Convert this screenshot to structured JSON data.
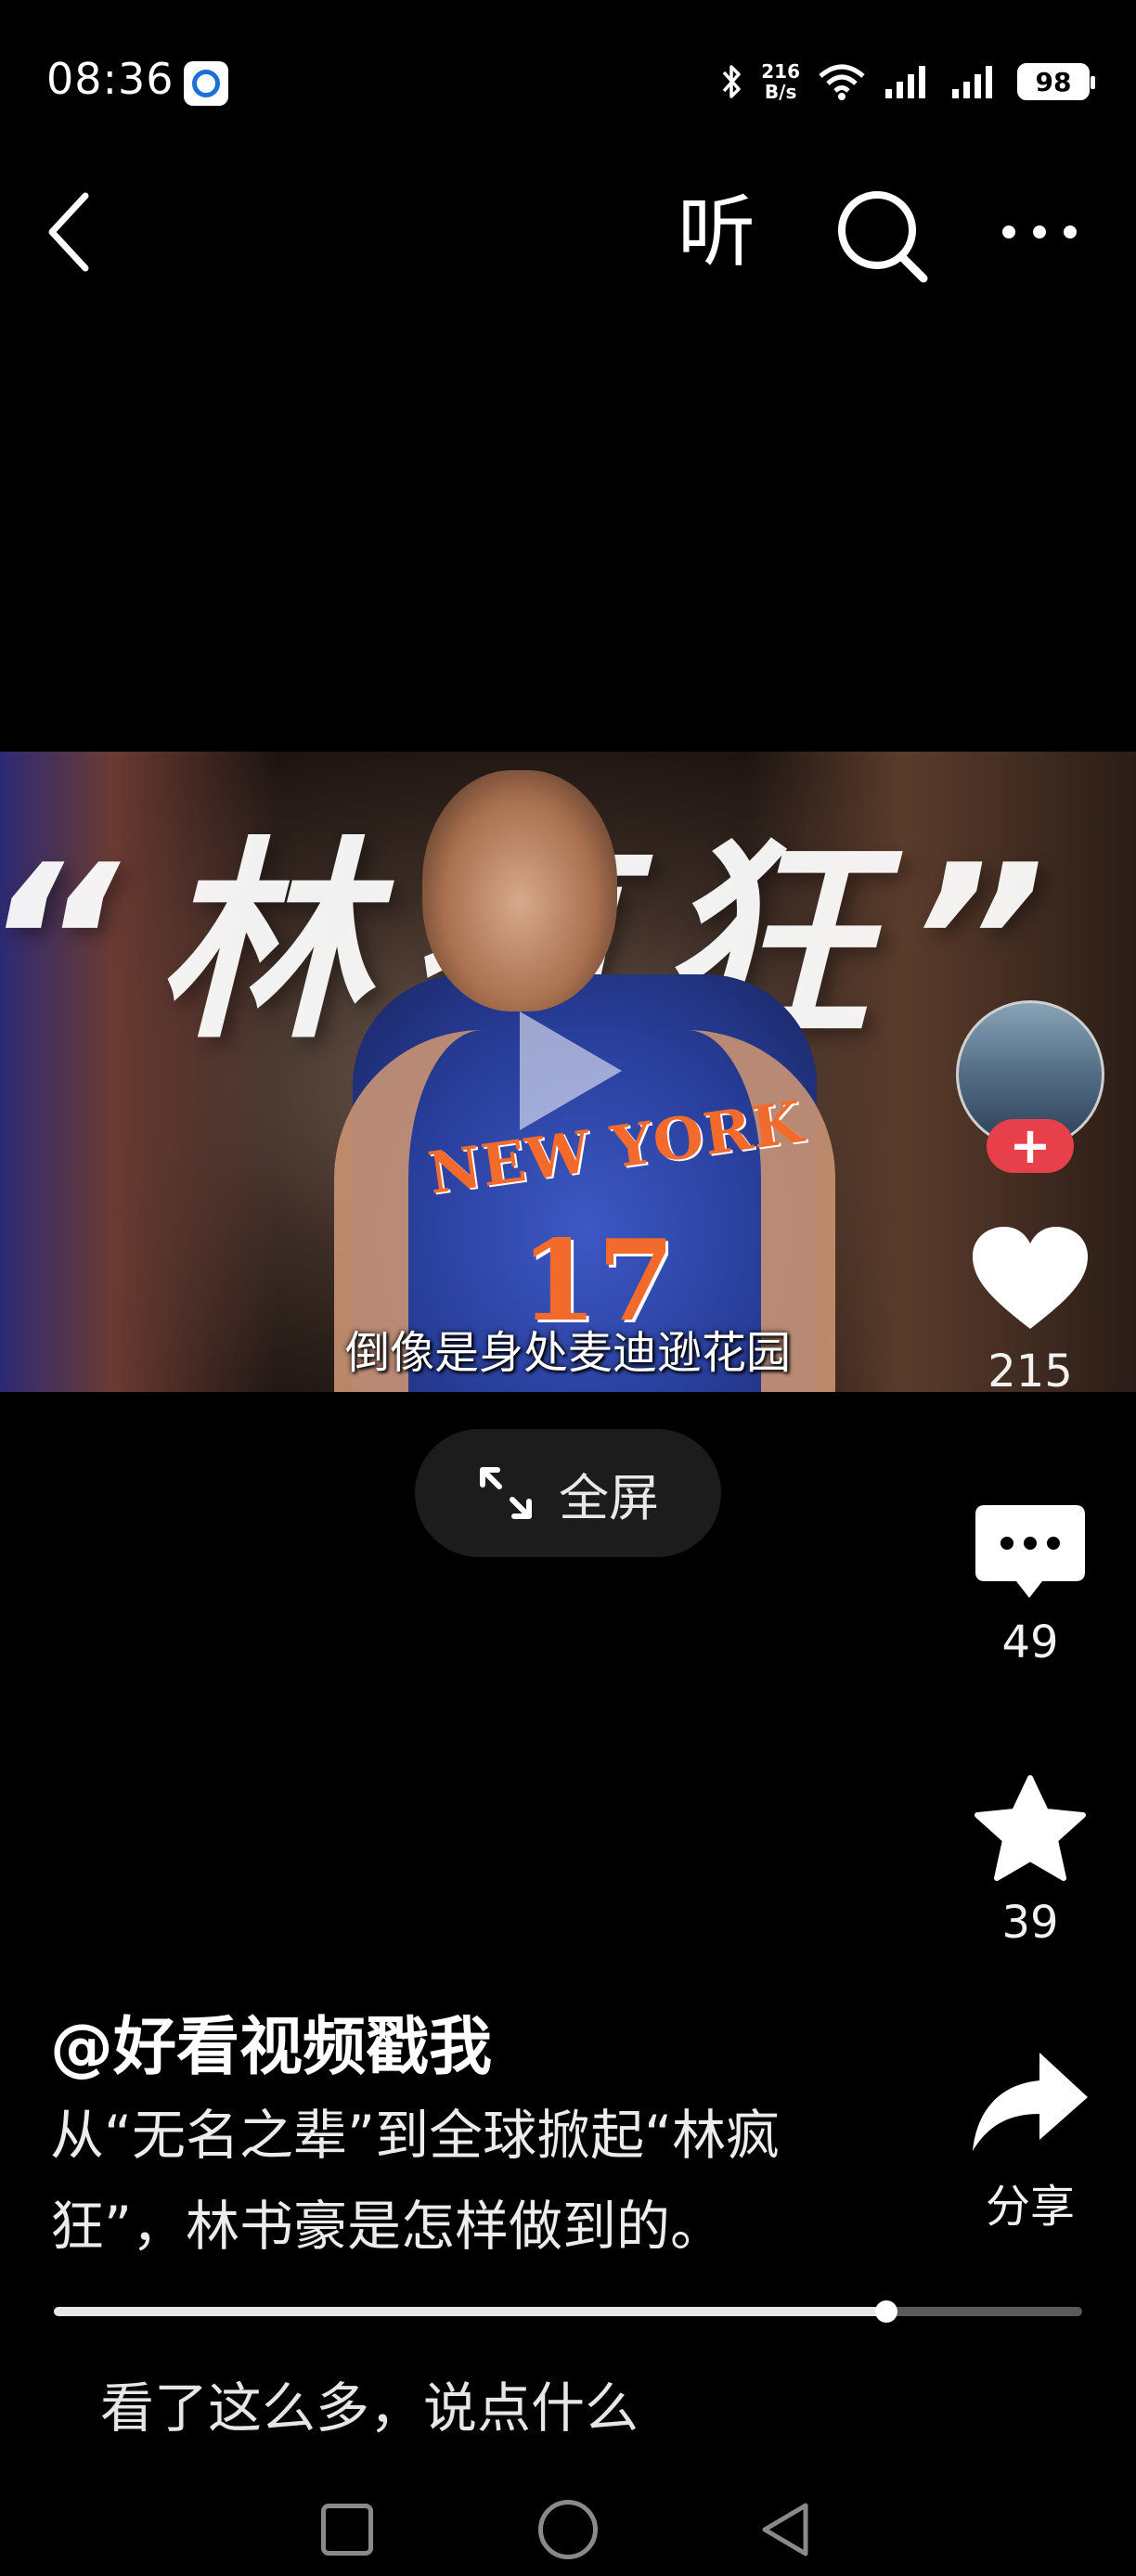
{
  "status_bar": {
    "time": "08:36",
    "net_speed_value": "216",
    "net_speed_unit": "B/s",
    "battery": "98"
  },
  "top_nav": {
    "listen_label": "听"
  },
  "video": {
    "overlay_title": "“林疯狂”",
    "jersey_text": "NEW YORK",
    "jersey_number": "17",
    "subtitle": "倒像是身处麦迪逊花园"
  },
  "fullscreen_label": "全屏",
  "actions": {
    "follow_label": "+",
    "like_count": "215",
    "comment_count": "49",
    "favorite_count": "39",
    "share_label": "分享"
  },
  "author": "@好看视频戳我",
  "description_line1": "从“无名之辈”到全球掀起“林疯",
  "description_line2": "狂”，林书豪是怎样做到的。",
  "progress": {
    "fraction": 0.81
  },
  "comment_placeholder": "看了这么多，说点什么"
}
